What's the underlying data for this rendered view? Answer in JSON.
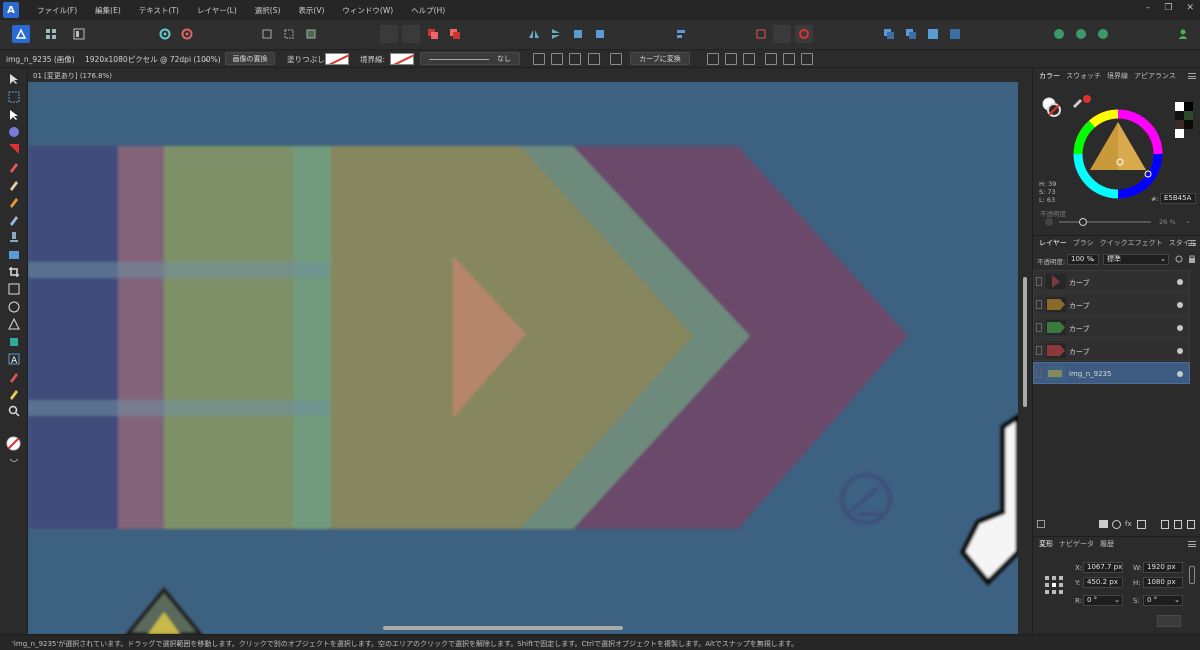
{
  "menu": {
    "items": [
      "ファイル(F)",
      "編集(E)",
      "テキスト(T)",
      "レイヤー(L)",
      "選択(S)",
      "表示(V)",
      "ウィンドウ(W)",
      "ヘルプ(H)"
    ]
  },
  "context": {
    "layer_name": "img_n_9235 (画像)",
    "image_info": "1920x1080ピクセル @ 72dpi (100%)",
    "replace_image": "画像の置換",
    "fill_label": "塗りつぶし:",
    "stroke_label": "境界線:",
    "stroke_style": "なし",
    "convert_curve": "カーブに変換"
  },
  "document": {
    "tab_title": "01 [変更あり] (176.8%)"
  },
  "color_panel": {
    "tabs": [
      "カラー",
      "スウォッチ",
      "境界線",
      "アピアランス"
    ],
    "h": "H: 39",
    "s": "S: 73",
    "l": "L: 63",
    "hex": "E5B45A",
    "hex_prefix": "#:",
    "opacity_label": "不透明度",
    "opacity_value": "26 %"
  },
  "layers_panel": {
    "tabs": [
      "レイヤー",
      "ブラシ",
      "クイックエフェクト",
      "スタイル"
    ],
    "opacity_label": "不透明度:",
    "opacity_value": "100 %",
    "blend_mode": "標準",
    "layers": [
      {
        "name": "カーブ",
        "color": "#7a3a3a"
      },
      {
        "name": "カーブ",
        "color": "#8a6a2a"
      },
      {
        "name": "カーブ",
        "color": "#3a7a3a"
      },
      {
        "name": "カーブ",
        "color": "#8a3a3a"
      },
      {
        "name": "img_n_9235",
        "color": "#3d6181"
      }
    ]
  },
  "transform_panel": {
    "tabs": [
      "変形",
      "ナビゲータ",
      "履歴"
    ],
    "x_label": "X:",
    "x": "1067.7 px",
    "y_label": "Y:",
    "y": "450.2 px",
    "w_label": "W:",
    "w": "1920 px",
    "h_label": "H:",
    "h": "1080 px",
    "r_label": "R:",
    "r": "0 °",
    "s_label": "S:",
    "s": "0 °"
  },
  "status": {
    "text": "'img_n_9235'が選択されています。ドラッグで選択範囲を移動します。クリックで別のオブジェクトを選択します。空のエリアのクリックで選択を解除します。Shiftで固定します。Ctrlで選択オブジェクトを複製します。Altでスナップを無視します。"
  },
  "colors": {
    "canvas_bg": "#3d6181",
    "accent": "#2a6ad1",
    "selected_layer": "#3d5a80"
  }
}
